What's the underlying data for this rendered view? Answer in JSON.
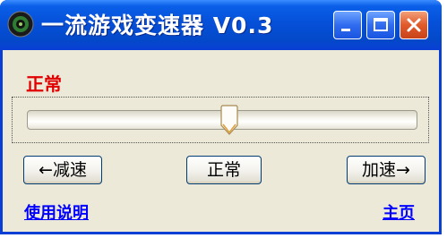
{
  "window": {
    "title": "一流游戏变速器 V0.3",
    "icon": "app-gear-icon",
    "controls": {
      "minimize_icon": "minimize-icon",
      "maximize_icon": "maximize-icon",
      "close_icon": "close-icon"
    }
  },
  "status": {
    "label": "正常",
    "color": "#e00000"
  },
  "speed_slider": {
    "value_fraction": 0.52,
    "thumb_icon": "slider-thumb"
  },
  "buttons": {
    "slow_label": "←减速",
    "normal_label": "正常",
    "fast_label": "加速→"
  },
  "links": {
    "help_label": "使用说明",
    "home_label": "主页"
  },
  "colors": {
    "titlebar": "#0650d8",
    "client_bg": "#ece9d8",
    "link": "#0000ff"
  }
}
